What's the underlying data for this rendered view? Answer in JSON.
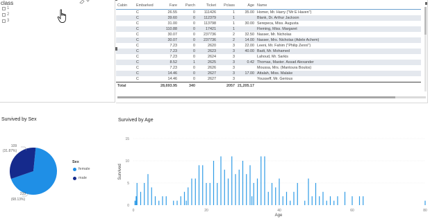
{
  "filter": {
    "title": "class",
    "items": [
      "1",
      "2",
      "3"
    ]
  },
  "table": {
    "columns": [
      "Cabin",
      "Embarked",
      "Fare",
      "Parch",
      "Ticket",
      "Pclass",
      "Age",
      "Name"
    ],
    "rows": [
      [
        "",
        "C",
        "26.55",
        "0",
        "111426",
        "1",
        "35.00",
        "Homer, Mr. Harry (\"Mr E Haven\")"
      ],
      [
        "",
        "C",
        "39.60",
        "0",
        "112379",
        "1",
        "",
        "Blank, Dr. Arthur Jackson"
      ],
      [
        "",
        "C",
        "31.00",
        "0",
        "113798",
        "1",
        "30.00",
        "Serepeca, Miss. Augusta"
      ],
      [
        "",
        "C",
        "110.88",
        "0",
        "17421",
        "1",
        "",
        "Fleming, Miss. Margaret"
      ],
      [
        "",
        "C",
        "30.07",
        "0",
        "237736",
        "2",
        "32.50",
        "Nasser, Mr. Nicholas"
      ],
      [
        "",
        "C",
        "30.07",
        "0",
        "237736",
        "2",
        "14.00",
        "Nasser, Mrs. Nicholas (Adele Achem)"
      ],
      [
        "",
        "C",
        "7.23",
        "0",
        "2620",
        "3",
        "22.00",
        "Leeni, Mr. Fahim (\"Philip Zenni\")"
      ],
      [
        "",
        "C",
        "7.23",
        "0",
        "2623",
        "3",
        "40.00",
        "Badt, Mr. Mohamed"
      ],
      [
        "",
        "C",
        "7.23",
        "0",
        "2624",
        "3",
        "",
        "Lahoud, Mr. Sarkis"
      ],
      [
        "",
        "C",
        "8.52",
        "1",
        "2625",
        "3",
        "0.42",
        "Thomas, Master. Assad Alexander"
      ],
      [
        "",
        "C",
        "7.23",
        "0",
        "2626",
        "3",
        "",
        "Moussa, Mrs. (Mantoura Boulos)"
      ],
      [
        "",
        "C",
        "14.46",
        "0",
        "2627",
        "3",
        "17.00",
        "Attalah, Miss. Malake"
      ],
      [
        "",
        "C",
        "14.46",
        "0",
        "2627",
        "3",
        "",
        "Yousseff, Mr. Gerious"
      ]
    ],
    "total": [
      "Total",
      "",
      "28,693.95",
      "340",
      "",
      "2057",
      "21,205.17",
      ""
    ]
  },
  "pie": {
    "title": "Survived by Sex",
    "legend_title": "Sex",
    "legend": [
      "female",
      "male"
    ],
    "label_top_value": "109",
    "label_top_pct": "(31.87%)",
    "label_bottom_value": "233",
    "label_bottom_pct": "(68.13%)",
    "colors": {
      "female": "#1f8fe6",
      "male": "#152a8c"
    }
  },
  "bar": {
    "title": "Survived by Age",
    "xlabel": "Age",
    "ylabel": "Survived",
    "color": "#2e9be6"
  },
  "chart_data": {
    "type": "bar",
    "title": "Survived by Age",
    "xlabel": "Age",
    "ylabel": "Survived",
    "xlim": [
      0,
      80
    ],
    "ylim": [
      0,
      15
    ],
    "x_ticks": [
      0,
      20,
      40,
      60,
      80
    ],
    "y_ticks": [
      0,
      5,
      10,
      15
    ],
    "x": [
      0.42,
      0.67,
      0.75,
      0.83,
      0.92,
      1,
      2,
      3,
      4,
      5,
      6,
      7,
      8,
      9,
      11,
      12,
      13,
      14,
      14.5,
      15,
      16,
      17,
      18,
      19,
      20,
      21,
      22,
      23,
      24,
      25,
      26,
      27,
      28,
      29,
      30,
      31,
      32,
      32.5,
      33,
      34,
      35,
      36,
      37,
      38,
      39,
      40,
      41,
      42,
      43,
      44,
      45,
      47,
      48,
      49,
      50,
      51,
      52,
      53,
      54,
      55,
      56,
      58,
      60,
      62,
      63,
      80
    ],
    "values": [
      1,
      1,
      2,
      2,
      1,
      5,
      3,
      5,
      7,
      4,
      2,
      1,
      2,
      2,
      1,
      1,
      2,
      3,
      1,
      4,
      6,
      6,
      9,
      9,
      5,
      5,
      10,
      5,
      11,
      8,
      6,
      11,
      7,
      8,
      10,
      7,
      9,
      2,
      5,
      6,
      11,
      11,
      3,
      5,
      4,
      6,
      2,
      3,
      1,
      3,
      5,
      1,
      6,
      2,
      5,
      2,
      3,
      1,
      2,
      1,
      2,
      3,
      2,
      2,
      2,
      1
    ]
  }
}
